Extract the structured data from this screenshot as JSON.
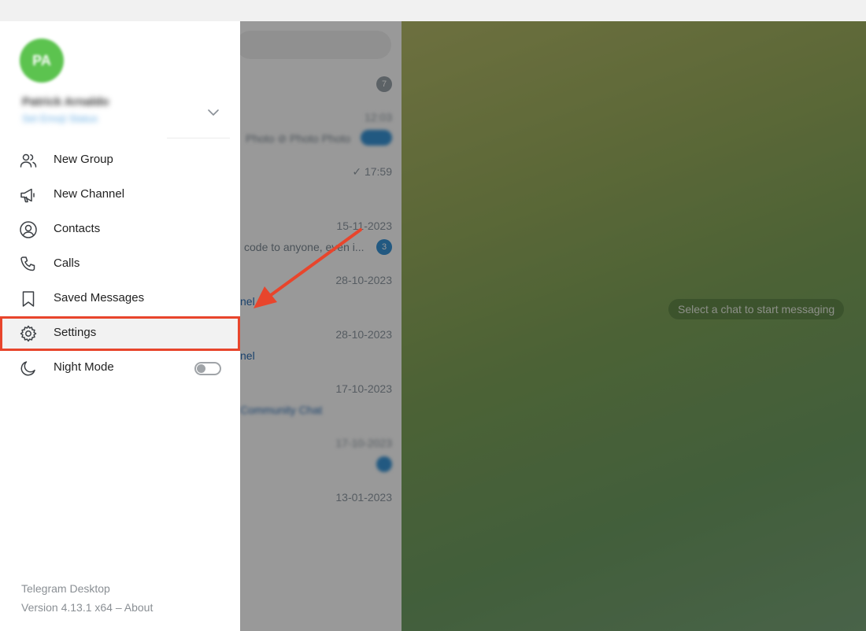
{
  "menu": {
    "avatar_initials": "PA",
    "user_name": "Patrick Arnaldo",
    "user_phone": "Set Emoji Status",
    "items": [
      {
        "label": "New Group",
        "icon": "group-icon"
      },
      {
        "label": "New Channel",
        "icon": "megaphone-icon"
      },
      {
        "label": "Contacts",
        "icon": "contact-icon"
      },
      {
        "label": "Calls",
        "icon": "phone-icon"
      },
      {
        "label": "Saved Messages",
        "icon": "bookmark-icon"
      },
      {
        "label": "Settings",
        "icon": "gear-icon"
      },
      {
        "label": "Night Mode",
        "icon": "moon-icon"
      }
    ],
    "night_mode": false,
    "footer_title": "Telegram Desktop",
    "footer_version": "Version 4.13.1 x64 – ",
    "footer_about": "About"
  },
  "chat_list": {
    "unread_top": "7",
    "rows": [
      {
        "time": "17:59",
        "snippet": "",
        "badge": ""
      },
      {
        "time": "15-11-2023",
        "snippet": "code to anyone, even i...",
        "badge": "3"
      },
      {
        "time": "28-10-2023",
        "snippet": "nel",
        "badge": ""
      },
      {
        "time": "28-10-2023",
        "snippet": "nel",
        "badge": ""
      },
      {
        "time": "17-10-2023",
        "snippet": "",
        "badge": ""
      },
      {
        "time": "13-01-2023",
        "snippet": "",
        "badge": ""
      }
    ]
  },
  "main": {
    "empty_state": "Select a chat to start messaging"
  },
  "colors": {
    "accent": "#3a95d8",
    "highlight": "#e8452c",
    "avatar": "#5cc34f"
  }
}
